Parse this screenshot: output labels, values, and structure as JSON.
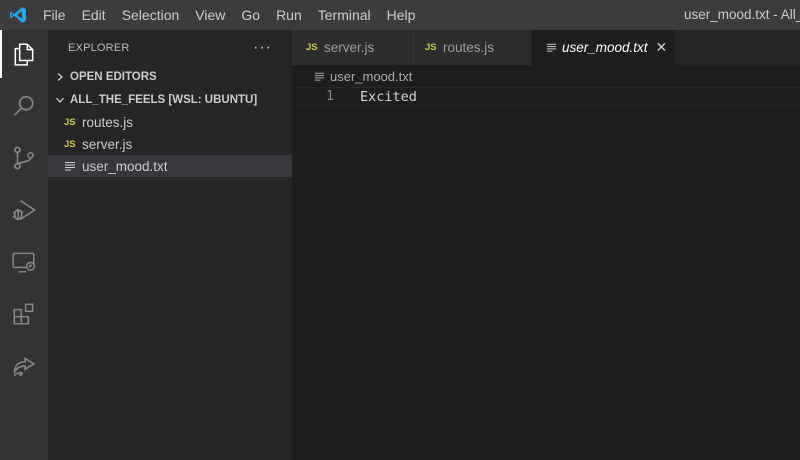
{
  "titlebar": {
    "logo_icon": "vscode-logo-icon",
    "menu": [
      "File",
      "Edit",
      "Selection",
      "View",
      "Go",
      "Run",
      "Terminal",
      "Help"
    ],
    "window_title": "user_mood.txt - All_Th"
  },
  "activitybar": {
    "items": [
      "explorer-icon",
      "search-icon",
      "source-control-icon",
      "run-debug-icon",
      "remote-explorer-icon",
      "extensions-icon",
      "live-share-icon"
    ]
  },
  "sidebar": {
    "title": "EXPLORER",
    "more": "···",
    "open_editors": "OPEN EDITORS",
    "workspace": "ALL_THE_FEELS [WSL: UBUNTU]",
    "files": [
      {
        "name": "routes.js",
        "icon_text": "JS"
      },
      {
        "name": "server.js",
        "icon_text": "JS"
      },
      {
        "name": "user_mood.txt"
      }
    ]
  },
  "tabs": [
    {
      "label": "server.js",
      "icon_text": "JS"
    },
    {
      "label": "routes.js",
      "icon_text": "JS"
    },
    {
      "label": "user_mood.txt",
      "close": "✕"
    }
  ],
  "editor": {
    "breadcrumb": "user_mood.txt",
    "lines": [
      {
        "number": "1",
        "text": "Excited"
      }
    ]
  },
  "colors": {
    "accent_js": "#cbcb41",
    "titlebar_bg": "#3c3c3c",
    "activitybar_bg": "#333333",
    "sidebar_bg": "#252526",
    "editor_bg": "#1e1e1e",
    "vscode_blue": "#23a9f2"
  }
}
